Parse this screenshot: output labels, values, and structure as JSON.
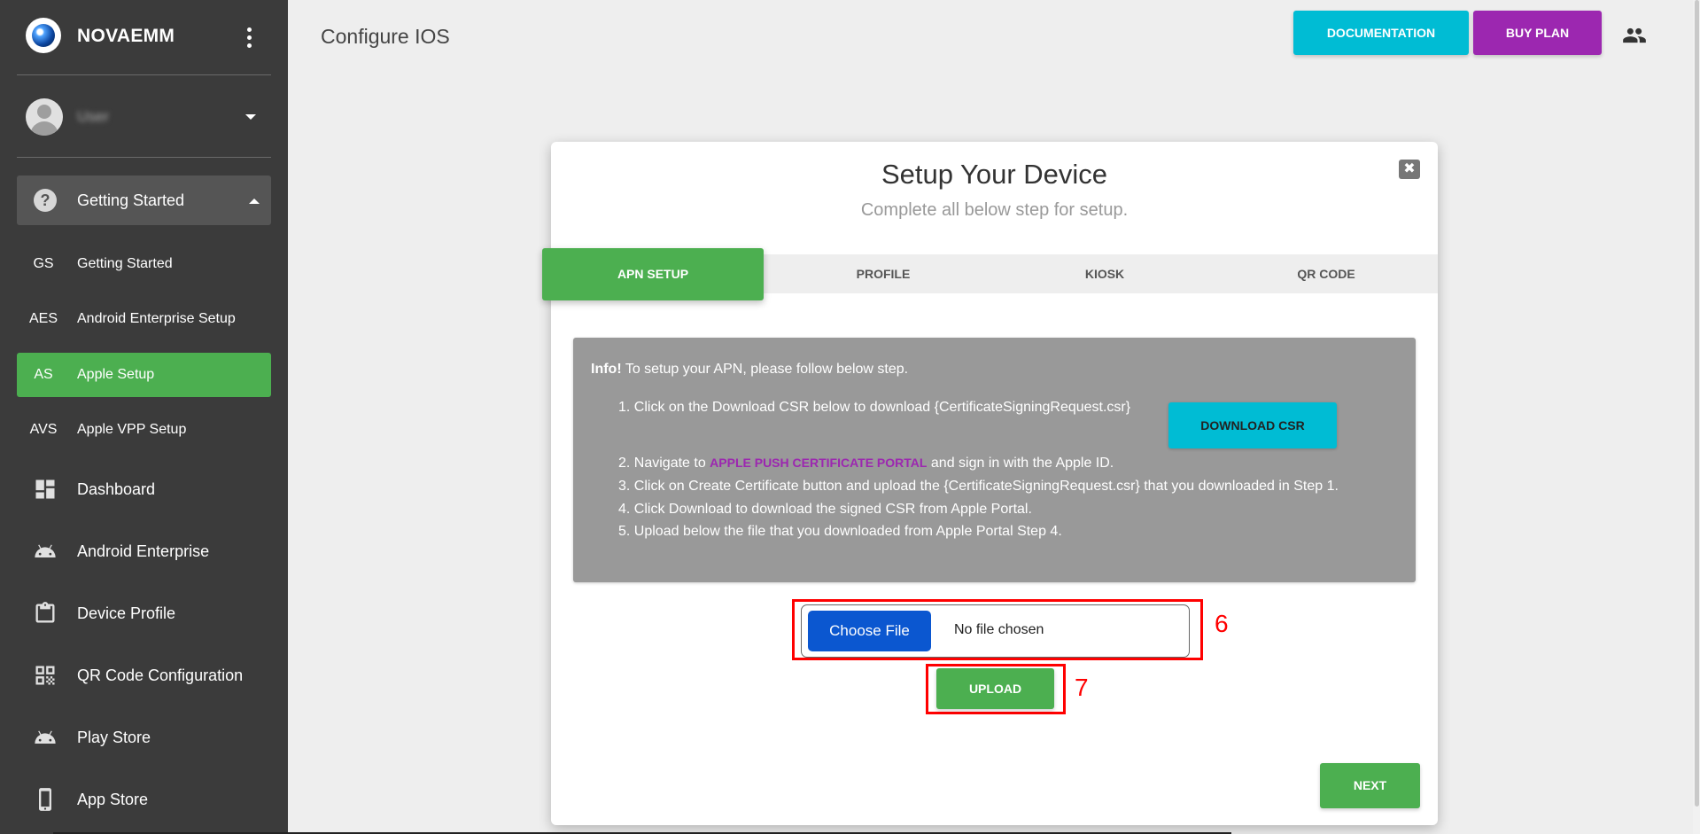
{
  "sidebar": {
    "brand": "NOVAEMM",
    "user_name": "User",
    "group": {
      "label": "Getting Started",
      "icon": "help-circle-icon"
    },
    "sub_items": [
      {
        "abbr": "GS",
        "label": "Getting Started"
      },
      {
        "abbr": "AES",
        "label": "Android Enterprise Setup"
      },
      {
        "abbr": "AS",
        "label": "Apple Setup",
        "active": true
      },
      {
        "abbr": "AVS",
        "label": "Apple VPP Setup"
      }
    ],
    "nav_items": [
      {
        "label": "Dashboard",
        "icon": "dashboard-icon"
      },
      {
        "label": "Android Enterprise",
        "icon": "android-icon"
      },
      {
        "label": "Device Profile",
        "icon": "clipboard-icon"
      },
      {
        "label": "QR Code Configuration",
        "icon": "qr-code-icon"
      },
      {
        "label": "Play Store",
        "icon": "android-icon"
      },
      {
        "label": "App Store",
        "icon": "phone-icon"
      }
    ]
  },
  "header": {
    "title": "Configure IOS",
    "documentation_label": "DOCUMENTATION",
    "buy_plan_label": "BUY PLAN"
  },
  "modal": {
    "title": "Setup Your Device",
    "subtitle": "Complete all below step for setup.",
    "tabs": [
      "APN SETUP",
      "PROFILE",
      "KIOSK",
      "QR CODE"
    ],
    "active_tab": "APN SETUP",
    "info": {
      "prefix": "Info!",
      "text": " To setup your APN, please follow below step.",
      "step1": "1. Click on the Download CSR below to download {CertificateSigningRequest.csr}",
      "download_csr_label": "DOWNLOAD CSR",
      "step2_before": "2. Navigate to ",
      "step2_link": "APPLE PUSH CERTIFICATE PORTAL",
      "step2_after": " and sign in with the Apple ID.",
      "step3": "3. Click on Create Certificate button and upload the {CertificateSigningRequest.csr} that you downloaded in Step 1.",
      "step4": "4. Click Download to download the signed CSR from Apple Portal.",
      "step5": "5. Upload below the file that you downloaded from Apple Portal Step 4."
    },
    "file_input": {
      "button_label": "Choose File",
      "status": "No file chosen"
    },
    "upload_label": "UPLOAD",
    "next_label": "NEXT",
    "annotations": {
      "file_step": "6",
      "upload_step": "7"
    }
  },
  "colors": {
    "sidebar_bg": "#3b3b3b",
    "active_green": "#4caf50",
    "cyan": "#00bcd4",
    "purple": "#9c27b0",
    "highlight_red": "#ff0000"
  }
}
